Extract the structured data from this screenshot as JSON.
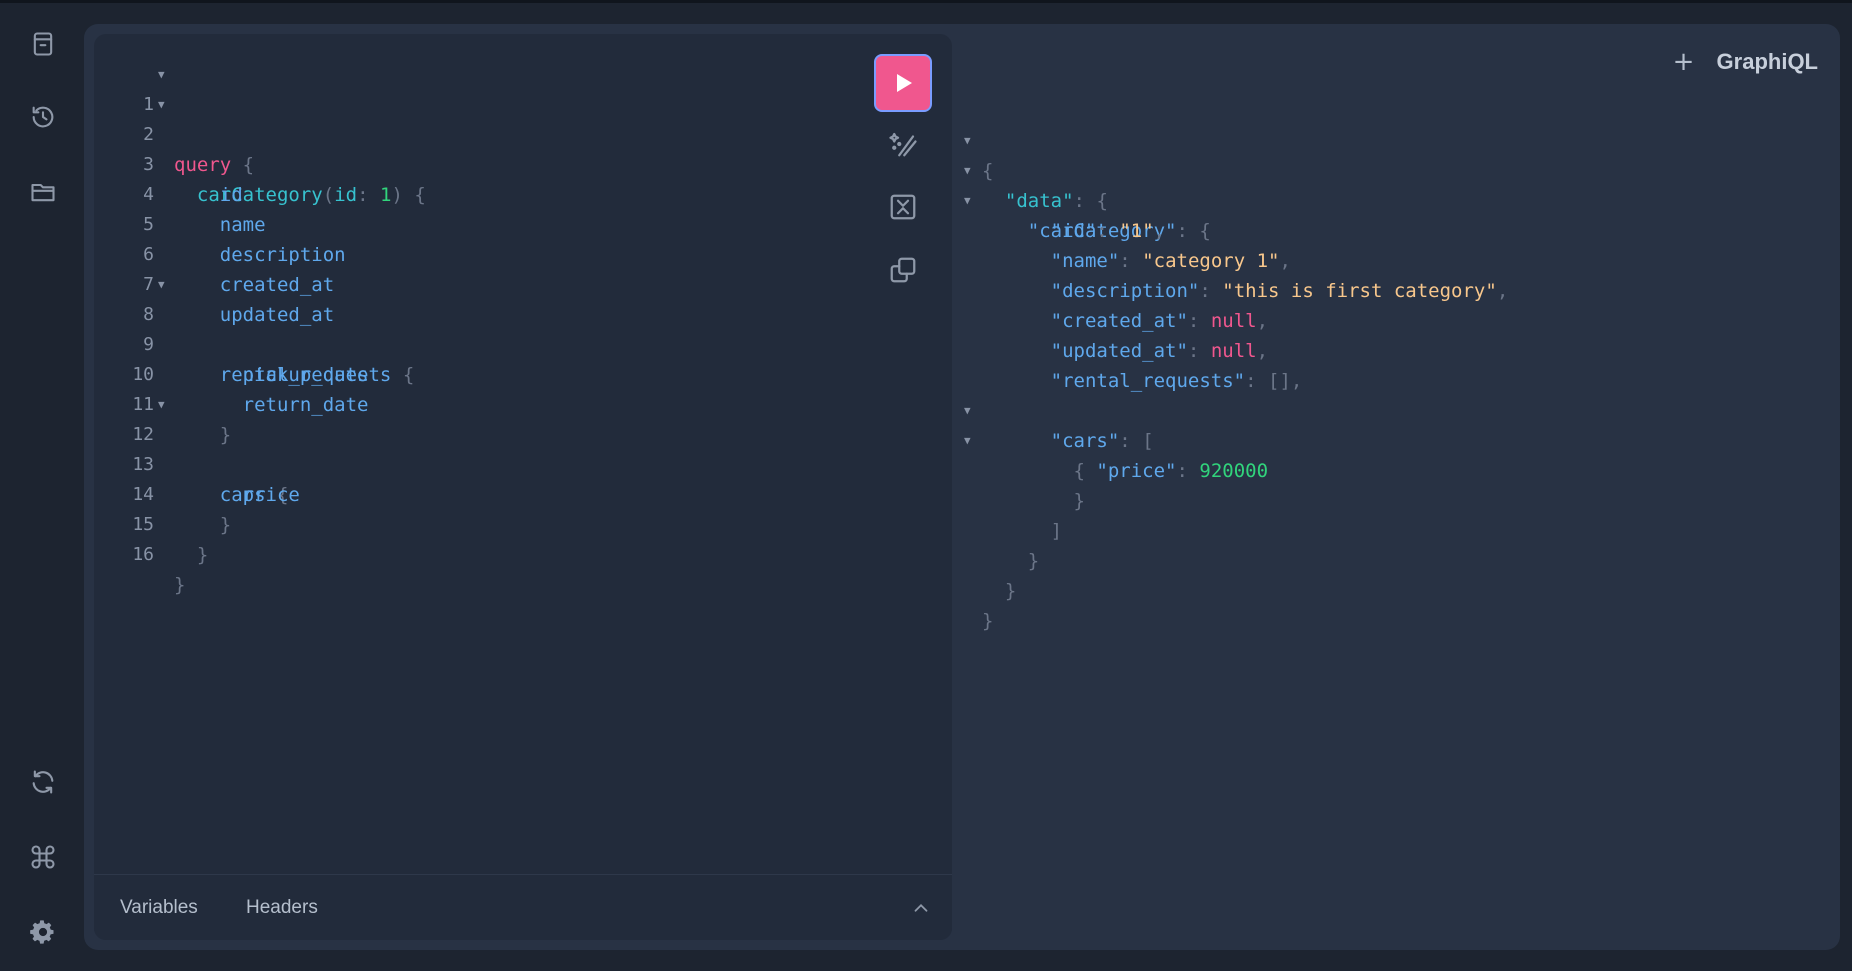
{
  "brand": {
    "title": "GraphiQL"
  },
  "sidebar": {
    "top_items": [
      {
        "icon": "docs-icon"
      },
      {
        "icon": "history-icon"
      },
      {
        "icon": "explorer-icon"
      }
    ],
    "bottom_items": [
      {
        "icon": "refetch-schema-icon"
      },
      {
        "icon": "shortcuts-icon"
      },
      {
        "icon": "settings-icon"
      }
    ]
  },
  "editor": {
    "line_numbers": [
      "1",
      "2",
      "3",
      "4",
      "5",
      "6",
      "7",
      "8",
      "9",
      "10",
      "11",
      "12",
      "13",
      "14",
      "15",
      "16"
    ],
    "query": {
      "l1_kw": "query",
      "l1_brace": "{",
      "l2_field": "carCategory",
      "l2_paren_open": "(",
      "l2_arg": "id",
      "l2_colon": ":",
      "l2_val": "1",
      "l2_paren_close": ")",
      "l2_brace": "{",
      "l3": "id",
      "l4": "name",
      "l5": "description",
      "l6": "created_at",
      "l7": "updated_at",
      "l8_field": "rental_requests",
      "l8_brace": "{",
      "l9": "pickup_date",
      "l10": "return_date",
      "l11": "}",
      "l12_field": "cars",
      "l12_brace": "{",
      "l13": "price",
      "l14": "}",
      "l15": "}",
      "l16": "}"
    },
    "tabs": {
      "variables": "Variables",
      "headers": "Headers"
    }
  },
  "response": {
    "open": "{",
    "data_key": "\"data\"",
    "colon": ":",
    "data_open": "{",
    "cat_key": "\"carCategory\"",
    "cat_open": "{",
    "id_key": "\"id\"",
    "id_val": "\"1\"",
    "name_key": "\"name\"",
    "name_val": "\"category 1\"",
    "desc_key": "\"description\"",
    "desc_val": "\"this is first category\"",
    "created_key": "\"created_at\"",
    "created_val": "null",
    "updated_key": "\"updated_at\"",
    "updated_val": "null",
    "rr_key": "\"rental_requests\"",
    "rr_val": "[]",
    "cars_key": "\"cars\"",
    "cars_open": "[",
    "obj_open": "{",
    "price_key": "\"price\"",
    "price_val": "920000",
    "obj_close": "}",
    "cars_close": "]",
    "cat_close": "}",
    "data_close": "}",
    "close": "}",
    "comma": ","
  },
  "colors": {
    "accent": "#f0578e",
    "background": "#1d2430",
    "panel": "#283244",
    "editor": "#222b3b"
  }
}
